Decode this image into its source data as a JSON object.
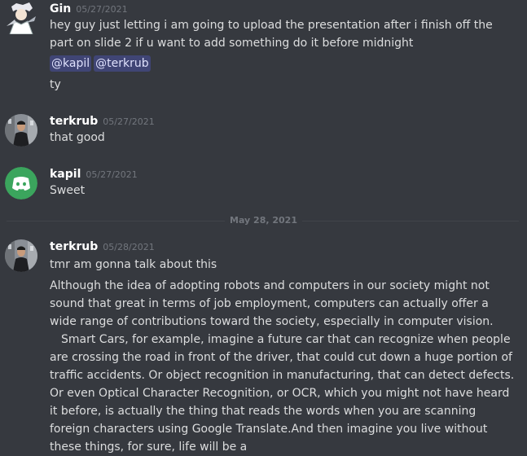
{
  "messages": [
    {
      "author": "Gin",
      "timestamp": "05/27/2021",
      "text": "hey guy just letting i am going to upload the presentation after i finish off the part on slide 2 if u want to add something do it before midnight",
      "mentions": [
        "@kapil",
        "@terkrub"
      ],
      "followup": "ty"
    },
    {
      "author": "terkrub",
      "timestamp": "05/27/2021",
      "text": "that good"
    },
    {
      "author": "kapil",
      "timestamp": "05/27/2021",
      "text": "Sweet"
    },
    {
      "author": "terkrub",
      "timestamp": "05/28/2021",
      "text": "tmr am gonna talk about this",
      "para1": "Although the idea of adopting robots and computers in our society might not sound that great in terms of job employment, computers can actually offer a wide range of contributions toward the society, especially in computer vision.",
      "para2": "Smart Cars, for example, imagine a future car that can recognize when people are crossing the road in front of the driver, that could cut down a huge portion of traffic accidents. Or object recognition in manufacturing, that can detect defects. Or even Optical Character Recognition, or OCR, which you might not have heard it before, is actually the thing that reads the words when you are scanning foreign characters using Google Translate.And then imagine you live without these things, for sure, life will be a"
    }
  ],
  "date_divider": "May 28, 2021",
  "colors": {
    "background": "#36393f",
    "discord_blurple": "#5865f2",
    "kapil_avatar_bg": "#3ba55d"
  }
}
